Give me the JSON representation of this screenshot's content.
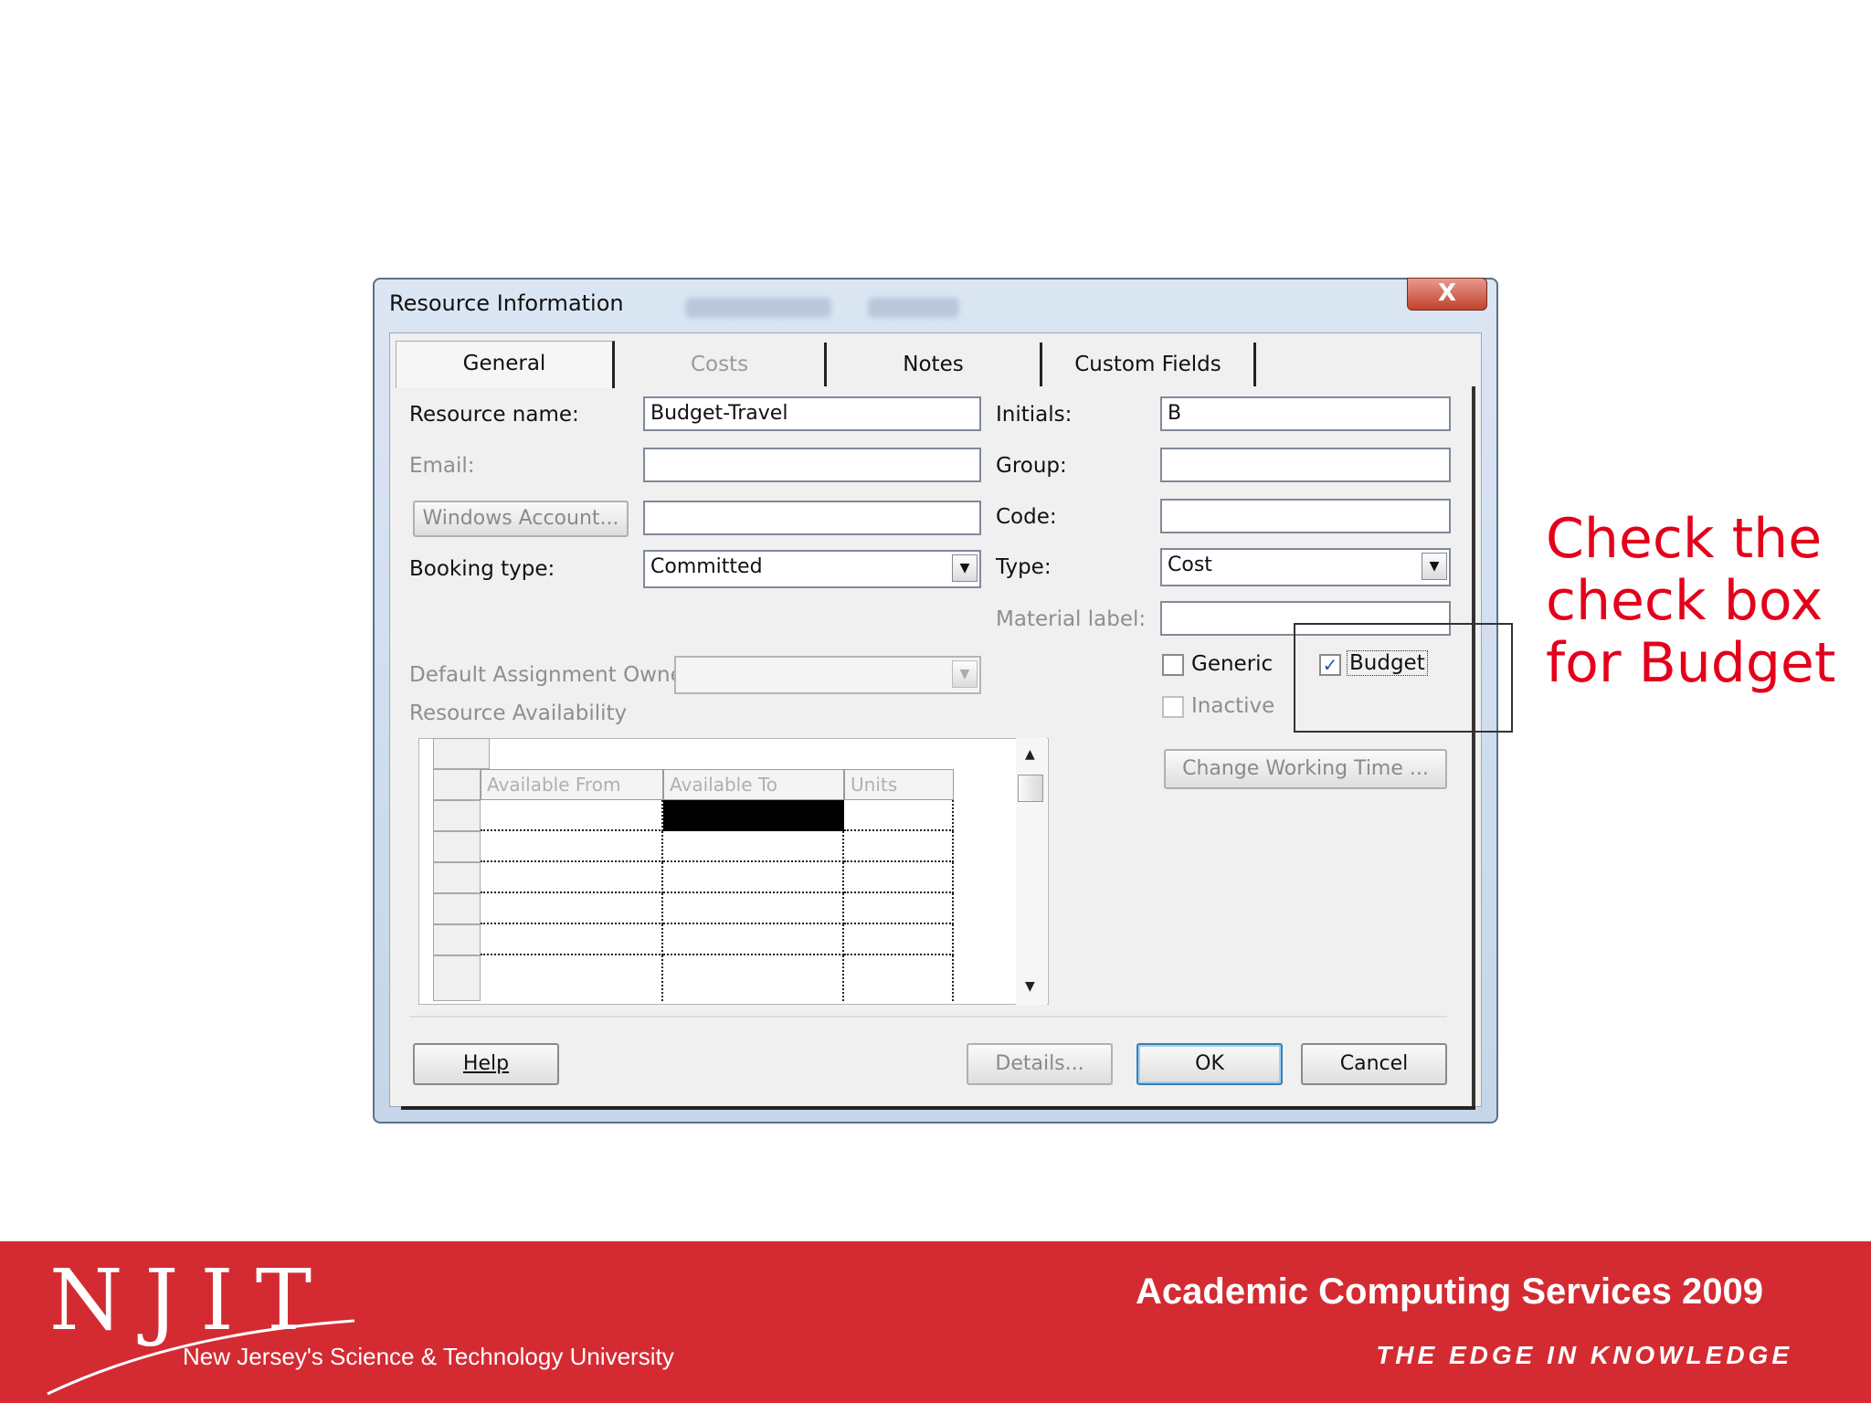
{
  "dialog": {
    "title": "Resource Information",
    "close_label": "X",
    "tabs": [
      {
        "label": "General",
        "active": true
      },
      {
        "label": "Costs",
        "disabled": true
      },
      {
        "label": "Notes"
      },
      {
        "label": "Custom Fields"
      }
    ],
    "fields": {
      "resource_name_label": "Resource name:",
      "resource_name_value": "Budget-Travel",
      "initials_label": "Initials:",
      "initials_value": "B",
      "email_label": "Email:",
      "group_label": "Group:",
      "windows_account_label": "Windows Account...",
      "code_label": "Code:",
      "booking_type_label": "Booking type:",
      "booking_type_value": "Committed",
      "type_label": "Type:",
      "type_value": "Cost",
      "material_label_label": "Material label:",
      "generic_label": "Generic",
      "budget_label": "Budget",
      "inactive_label": "Inactive",
      "default_owner_label": "Default Assignment Owner:",
      "availability_label": "Resource Availability",
      "change_working_time_label": "Change Working Time ..."
    },
    "checkboxes": {
      "generic": false,
      "budget": true,
      "inactive": false
    },
    "grid": {
      "columns": [
        "Available From",
        "Available To",
        "Units"
      ]
    },
    "buttons": {
      "help": "Help",
      "details": "Details...",
      "ok": "OK",
      "cancel": "Cancel"
    }
  },
  "callout": {
    "text": "Check the check box for Budget"
  },
  "footer": {
    "logo": "NJIT",
    "university": "New Jersey's Science & Technology University",
    "title": "Academic Computing Services 2009",
    "tagline": "THE EDGE IN KNOWLEDGE"
  },
  "colors": {
    "callout": "#e4001b",
    "footer_bg": "#d42b32"
  }
}
